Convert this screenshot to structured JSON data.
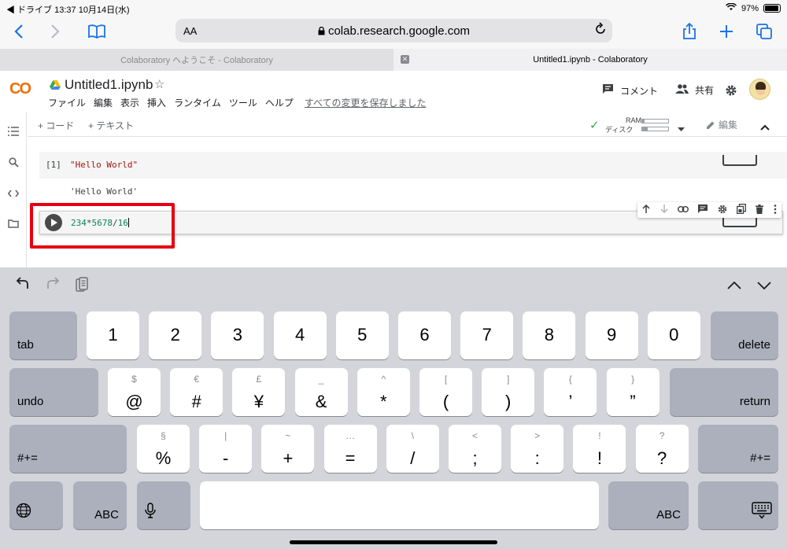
{
  "status_bar": {
    "left": "◀ ドライブ  13:37  10月14日(水)",
    "battery": "97%"
  },
  "browser": {
    "text_size_button": "AA",
    "url": "colab.research.google.com",
    "tabs": [
      {
        "title": "Colaboratory へようこそ - Colaboratory"
      },
      {
        "title": "Untitled1.ipynb - Colaboratory"
      }
    ]
  },
  "colab": {
    "logo": "CO",
    "notebook_title": "Untitled1.ipynb",
    "menu": [
      "ファイル",
      "編集",
      "表示",
      "挿入",
      "ランタイム",
      "ツール",
      "ヘルプ"
    ],
    "save_status": "すべての変更を保存しました",
    "comment_label": "コメント",
    "share_label": "共有",
    "toolbar": {
      "add_code": "+ コード",
      "add_text": "+ テキスト",
      "ram_label": "RAM",
      "disk_label": "ディスク",
      "edit_label": "編集"
    },
    "cells": [
      {
        "prompt": "[1]",
        "code": "\"Hello World\"",
        "output": "'Hello World'"
      },
      {
        "code_parts": [
          "234",
          "*",
          "5678",
          "/",
          "16"
        ]
      }
    ]
  },
  "keyboard": {
    "row1": {
      "left": "tab",
      "keys": [
        "1",
        "2",
        "3",
        "4",
        "5",
        "6",
        "7",
        "8",
        "9",
        "0"
      ],
      "right": "delete"
    },
    "row2": {
      "left": "undo",
      "keys": [
        {
          "main": "@",
          "sub": "$"
        },
        {
          "main": "#",
          "sub": "€"
        },
        {
          "main": "¥",
          "sub": "£"
        },
        {
          "main": "&",
          "sub": "_"
        },
        {
          "main": "*",
          "sub": "^"
        },
        {
          "main": "(",
          "sub": "["
        },
        {
          "main": ")",
          "sub": "]"
        },
        {
          "main": "’",
          "sub": "{"
        },
        {
          "main": "”",
          "sub": "}"
        }
      ],
      "right": "return"
    },
    "row3": {
      "left": "#+=",
      "keys": [
        {
          "main": "%",
          "sub": "§"
        },
        {
          "main": "-",
          "sub": "|"
        },
        {
          "main": "+",
          "sub": "~"
        },
        {
          "main": "=",
          "sub": "…"
        },
        {
          "main": "/",
          "sub": "\\"
        },
        {
          "main": ";",
          "sub": "<"
        },
        {
          "main": ":",
          "sub": ">"
        },
        {
          "main": "!",
          "sub": "!"
        },
        {
          "main": "?",
          "sub": "?"
        }
      ],
      "right": "#+="
    },
    "row4": {
      "abc_left": "ABC",
      "abc_right": "ABC"
    }
  }
}
